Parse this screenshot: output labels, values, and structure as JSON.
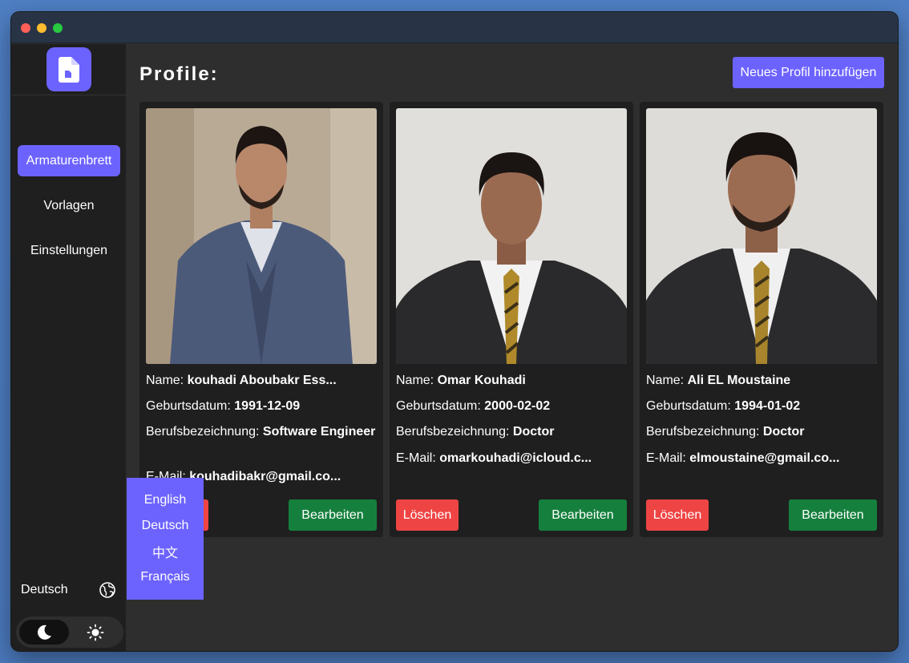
{
  "sidebar": {
    "items": [
      {
        "label": "Armaturenbrett",
        "active": true
      },
      {
        "label": "Vorlagen",
        "active": false
      },
      {
        "label": "Einstellungen",
        "active": false
      }
    ],
    "language_label": "Deutsch",
    "theme": "dark"
  },
  "header": {
    "title": "Profile:",
    "add_button_label": "Neues Profil hinzufügen"
  },
  "labels": {
    "name": "Name:",
    "birthdate": "Geburtsdatum:",
    "job": "Berufsbezeichnung:",
    "email": "E-Mail:",
    "delete": "Löschen",
    "edit": "Bearbeiten"
  },
  "profiles": [
    {
      "name": "kouhadi Aboubakr Ess...",
      "birthdate": "1991-12-09",
      "job": "Software Engineer",
      "email": "kouhadibakr@gmail.co..."
    },
    {
      "name": "Omar Kouhadi",
      "birthdate": "2000-02-02",
      "job": "Doctor",
      "email": "omarkouhadi@icloud.c..."
    },
    {
      "name": "Ali EL Moustaine",
      "birthdate": "1994-01-02",
      "job": "Doctor",
      "email": "elmoustaine@gmail.co..."
    }
  ],
  "language_menu": {
    "options": [
      "English",
      "Deutsch",
      "中文",
      "Français"
    ]
  },
  "colors": {
    "accent": "#6c63ff",
    "delete": "#ef4444",
    "edit": "#15803d",
    "sidebar_bg": "#1f1f1f",
    "main_bg": "#2e2e2e"
  },
  "icons": {
    "logo": "document-icon",
    "globe": "globe-icon",
    "dark_mode": "moon-icon",
    "light_mode": "sun-icon"
  }
}
